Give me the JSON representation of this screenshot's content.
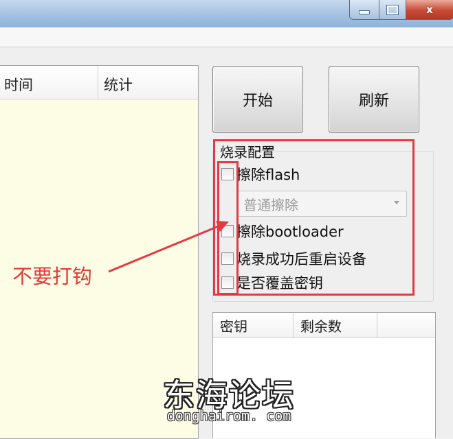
{
  "window": {
    "controls": {
      "minimize_icon": "minimize-icon",
      "maximize_icon": "maximize-icon",
      "close_glyph": "x"
    }
  },
  "buttons": {
    "start_label": "开始",
    "refresh_label": "刷新"
  },
  "log_table": {
    "columns": [
      "时间",
      "统计"
    ]
  },
  "flash_config": {
    "title": "烧录配置",
    "erase_flash_label": "擦除flash",
    "erase_mode": {
      "value": "普通擦除"
    },
    "erase_bootloader_label": "擦除bootloader",
    "reboot_label": "烧录成功后重启设备",
    "overwrite_key_label": "是否覆盖密钥"
  },
  "annotation": {
    "text": "不要打钩",
    "color": "#e23b37"
  },
  "key_table": {
    "columns": [
      "密钥",
      "剩余数"
    ]
  },
  "watermark": {
    "cn": "东海论坛",
    "en": "donghairom. com"
  }
}
